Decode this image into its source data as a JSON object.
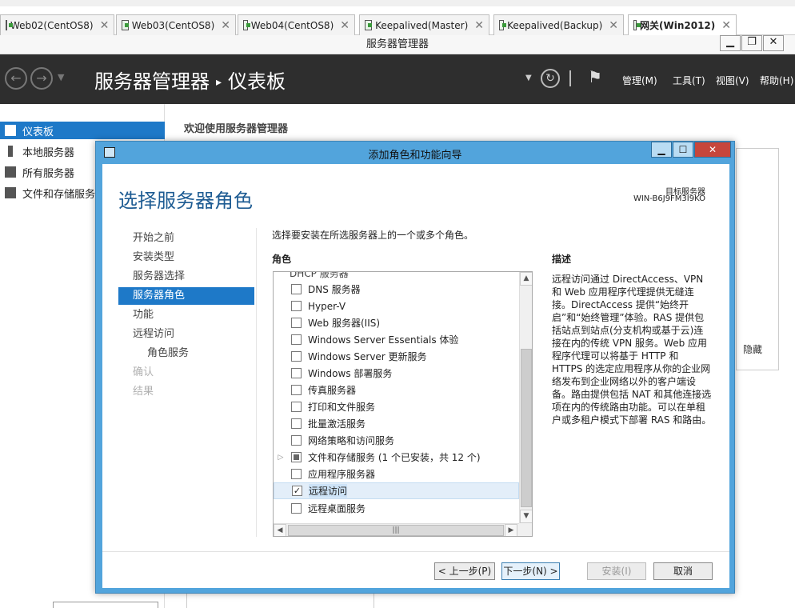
{
  "vm_tabs": [
    {
      "label": "Web02(CentOS8)"
    },
    {
      "label": "Web03(CentOS8)"
    },
    {
      "label": "Web04(CentOS8)"
    },
    {
      "label": "Keepalived(Master)"
    },
    {
      "label": "Keepalived(Backup)"
    },
    {
      "label": "网关(Win2012)"
    }
  ],
  "host_window": {
    "title": "服务器管理器",
    "minimize": "▁",
    "restore": "❐",
    "close": "✕"
  },
  "server_manager": {
    "title": "服务器管理器",
    "separator": "▸",
    "page": "仪表板",
    "menus": [
      "管理(M)",
      "工具(T)",
      "视图(V)",
      "帮助(H)"
    ],
    "nav": [
      {
        "label": "仪表板",
        "icon": "dashboard-icon"
      },
      {
        "label": "本地服务器",
        "icon": "local-server-icon"
      },
      {
        "label": "所有服务器",
        "icon": "all-servers-icon"
      },
      {
        "label": "文件和存储服务",
        "icon": "file-storage-icon"
      }
    ],
    "welcome": "欢迎使用服务器管理器",
    "hide_link": "隐藏"
  },
  "wizard": {
    "title": "添加角色和功能向导",
    "page_title": "选择服务器角色",
    "target_label": "目标服务器",
    "target_server": "WIN-B6J9FM3I9KO",
    "steps": [
      {
        "label": "开始之前",
        "state": "normal"
      },
      {
        "label": "安装类型",
        "state": "normal"
      },
      {
        "label": "服务器选择",
        "state": "normal"
      },
      {
        "label": "服务器角色",
        "state": "current"
      },
      {
        "label": "功能",
        "state": "normal"
      },
      {
        "label": "远程访问",
        "state": "normal"
      },
      {
        "label": "角色服务",
        "state": "sub"
      },
      {
        "label": "确认",
        "state": "disabled"
      },
      {
        "label": "结果",
        "state": "disabled"
      }
    ],
    "instruction": "选择要安装在所选服务器上的一个或多个角色。",
    "roles_header": "角色",
    "roles_cutoff": "DHCP 服务器",
    "roles": [
      {
        "label": "DNS 服务器",
        "checked": false
      },
      {
        "label": "Hyper-V",
        "checked": false
      },
      {
        "label": "Web 服务器(IIS)",
        "checked": false
      },
      {
        "label": "Windows Server Essentials 体验",
        "checked": false
      },
      {
        "label": "Windows Server 更新服务",
        "checked": false
      },
      {
        "label": "Windows 部署服务",
        "checked": false
      },
      {
        "label": "传真服务器",
        "checked": false
      },
      {
        "label": "打印和文件服务",
        "checked": false
      },
      {
        "label": "批量激活服务",
        "checked": false
      },
      {
        "label": "网络策略和访问服务",
        "checked": false
      },
      {
        "label": "文件和存储服务 (1 个已安装，共 12 个)",
        "checked": "partial",
        "expandable": true
      },
      {
        "label": "应用程序服务器",
        "checked": false
      },
      {
        "label": "远程访问",
        "checked": true,
        "selected": true
      },
      {
        "label": "远程桌面服务",
        "checked": false
      }
    ],
    "description_header": "描述",
    "description": "远程访问通过 DirectAccess、VPN 和 Web 应用程序代理提供无缝连接。DirectAccess 提供“始终开启”和“始终管理”体验。RAS 提供包括站点到站点(分支机构或基于云)连接在内的传统 VPN 服务。Web 应用程序代理可以将基于 HTTP 和 HTTPS 的选定应用程序从你的企业网络发布到企业网络以外的客户端设备。路由提供包括 NAT 和其他连接选项在内的传统路由功能。可以在单租户或多租户模式下部署 RAS 和路由。",
    "buttons": {
      "prev": "< 上一步(P)",
      "next": "下一步(N) >",
      "install": "安装(I)",
      "cancel": "取消"
    }
  }
}
